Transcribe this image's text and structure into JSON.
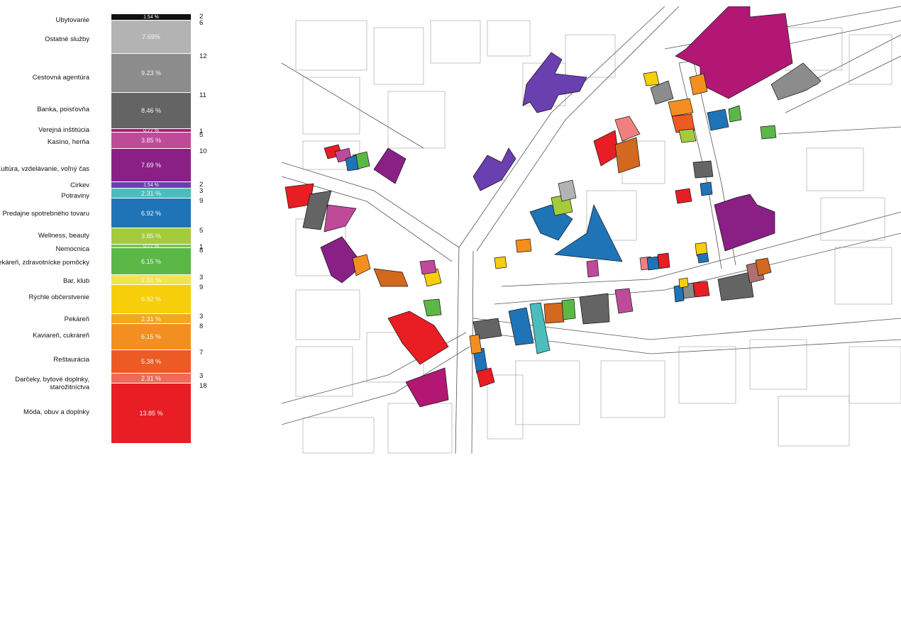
{
  "legend": {
    "categories": [
      {
        "label": "Ubytovanie",
        "percent": "1.54 %",
        "count": "2",
        "color": "#111111",
        "text_color": "#ffffff"
      },
      {
        "label": "Ostatné služby",
        "percent": "7.69%",
        "count": "6",
        "color": "#b3b3b3"
      },
      {
        "label": "Cestovná agentúra",
        "percent": "9.23 %",
        "count": "12",
        "color": "#8c8c8c"
      },
      {
        "label": "Banka, poisťovňa",
        "percent": "8.46 %",
        "count": "11",
        "color": "#646464"
      },
      {
        "label": "Verejná inštitúcia",
        "percent": "0.77 %",
        "count": "1",
        "color": "#b21873"
      },
      {
        "label": "Kasíno, herňa",
        "percent": "3.85 %",
        "count": "5",
        "color": "#c04a9a"
      },
      {
        "label": "Kultúra, vzdelávanie, voľný čas",
        "percent": "7.69 %",
        "count": "10",
        "color": "#8a1f86"
      },
      {
        "label": "Cirkev",
        "percent": "1.54 %",
        "count": "2",
        "color": "#6a3fb0"
      },
      {
        "label": "Potraviny",
        "percent": "2.31 %",
        "count": "3",
        "color": "#4bbdbd"
      },
      {
        "label": "Predajne spotrebného tovaru",
        "percent": "6.92 %",
        "count": "9",
        "color": "#1f74b8"
      },
      {
        "label": "Wellness, beauty",
        "percent": "3.85 %",
        "count": "5",
        "color": "#a4cb3c"
      },
      {
        "label": "Nemocnica",
        "percent": "0.77 %",
        "count": "1",
        "color": "#7fc257"
      },
      {
        "label": "Lekáreň, zdravotnícke pomôcky",
        "percent": "6.15 %",
        "count": "8",
        "color": "#5bb847"
      },
      {
        "label": "Bar, klub",
        "percent": "2.31 %",
        "count": "3",
        "color": "#f4e34c"
      },
      {
        "label": "Rýchle občerstvenie",
        "percent": "6.92 %",
        "count": "9",
        "color": "#f6cf0a"
      },
      {
        "label": "Pekáreň",
        "percent": "2.31 %",
        "count": "3",
        "color": "#f5a623"
      },
      {
        "label": "Kaviareň, cukráreň",
        "percent": "6.15 %",
        "count": "8",
        "color": "#f38f20"
      },
      {
        "label": "Reštaurácia",
        "percent": "5.38 %",
        "count": "7",
        "color": "#ee5a24"
      },
      {
        "label": "Darčeky, bytové doplnky, starožitníctva",
        "percent": "2.31 %",
        "count": "3",
        "color": "#f06a5a"
      },
      {
        "label": "Móda, obuv a doplnky",
        "percent": "13.85 %",
        "count": "18",
        "color": "#e91d24"
      }
    ]
  },
  "map": {
    "background": "#ffffff",
    "outline_color": "#555555",
    "building_outline_color": "#111111",
    "palette": {
      "fashion": "#e91d24",
      "gifts": "#f06a5a",
      "restaurant": "#ee5a24",
      "cafe": "#f38f20",
      "bakery": "#f5a623",
      "fastfood": "#f6cf0a",
      "bar": "#f4e34c",
      "pharmacy": "#5bb847",
      "wellness": "#a4cb3c",
      "consumer": "#1f74b8",
      "grocery": "#4bbdbd",
      "church": "#6a3fb0",
      "culture": "#8a1f86",
      "casino": "#c04a9a",
      "public": "#b21873",
      "bank": "#646464",
      "travel": "#8c8c8c",
      "services": "#b3b3b3",
      "accommodation": "#111111",
      "brown": "#d2691e",
      "pink": "#f08080",
      "rose": "#b07070"
    }
  }
}
